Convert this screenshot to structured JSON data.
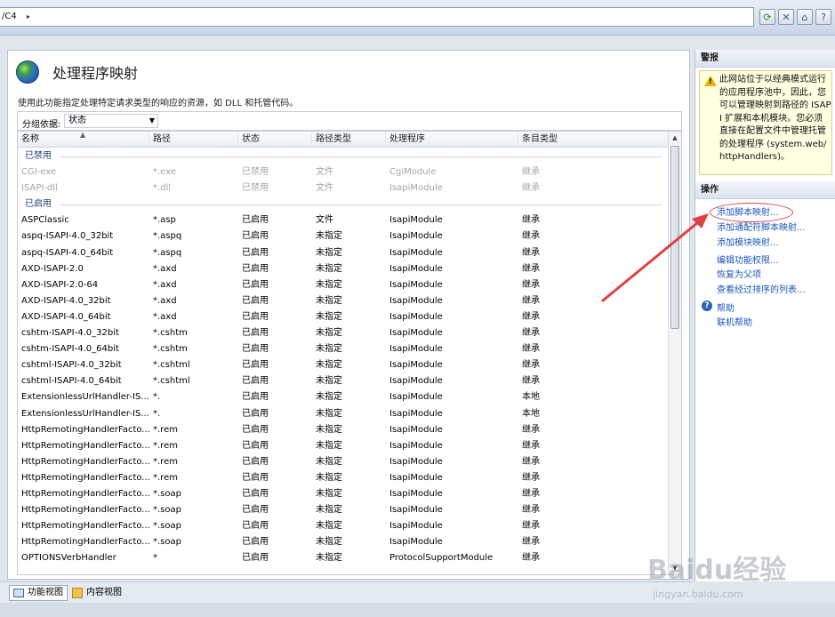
{
  "address": {
    "text": "/C4",
    "separator": "▸"
  },
  "toolbar_icons": [
    "refresh-icon",
    "stop-icon",
    "home-icon",
    "help-icon"
  ],
  "main": {
    "title": "处理程序映射",
    "description": "使用此功能指定处理特定请求类型的响应的资源，如 DLL 和托管代码。",
    "group_by_label": "分组依据:",
    "group_by_value": "状态",
    "columns": [
      "名称",
      "路径",
      "状态",
      "路径类型",
      "处理程序",
      "条目类型"
    ],
    "groups": [
      {
        "label": "已禁用",
        "disabled": true,
        "rows": [
          [
            "CGI-exe",
            "*.exe",
            "已禁用",
            "文件",
            "CgiModule",
            "继承"
          ],
          [
            "ISAPI-dll",
            "*.dll",
            "已禁用",
            "文件",
            "IsapiModule",
            "继承"
          ]
        ]
      },
      {
        "label": "已启用",
        "disabled": false,
        "rows": [
          [
            "ASPClassic",
            "*.asp",
            "已启用",
            "文件",
            "IsapiModule",
            "继承"
          ],
          [
            "aspq-ISAPI-4.0_32bit",
            "*.aspq",
            "已启用",
            "未指定",
            "IsapiModule",
            "继承"
          ],
          [
            "aspq-ISAPI-4.0_64bit",
            "*.aspq",
            "已启用",
            "未指定",
            "IsapiModule",
            "继承"
          ],
          [
            "AXD-ISAPI-2.0",
            "*.axd",
            "已启用",
            "未指定",
            "IsapiModule",
            "继承"
          ],
          [
            "AXD-ISAPI-2.0-64",
            "*.axd",
            "已启用",
            "未指定",
            "IsapiModule",
            "继承"
          ],
          [
            "AXD-ISAPI-4.0_32bit",
            "*.axd",
            "已启用",
            "未指定",
            "IsapiModule",
            "继承"
          ],
          [
            "AXD-ISAPI-4.0_64bit",
            "*.axd",
            "已启用",
            "未指定",
            "IsapiModule",
            "继承"
          ],
          [
            "cshtm-ISAPI-4.0_32bit",
            "*.cshtm",
            "已启用",
            "未指定",
            "IsapiModule",
            "继承"
          ],
          [
            "cshtm-ISAPI-4.0_64bit",
            "*.cshtm",
            "已启用",
            "未指定",
            "IsapiModule",
            "继承"
          ],
          [
            "cshtml-ISAPI-4.0_32bit",
            "*.cshtml",
            "已启用",
            "未指定",
            "IsapiModule",
            "继承"
          ],
          [
            "cshtml-ISAPI-4.0_64bit",
            "*.cshtml",
            "已启用",
            "未指定",
            "IsapiModule",
            "继承"
          ],
          [
            "ExtensionlessUrlHandler-IS...",
            "*.",
            "已启用",
            "未指定",
            "IsapiModule",
            "本地"
          ],
          [
            "ExtensionlessUrlHandler-IS...",
            "*.",
            "已启用",
            "未指定",
            "IsapiModule",
            "本地"
          ],
          [
            "HttpRemotingHandlerFacto...",
            "*.rem",
            "已启用",
            "未指定",
            "IsapiModule",
            "继承"
          ],
          [
            "HttpRemotingHandlerFacto...",
            "*.rem",
            "已启用",
            "未指定",
            "IsapiModule",
            "继承"
          ],
          [
            "HttpRemotingHandlerFacto...",
            "*.rem",
            "已启用",
            "未指定",
            "IsapiModule",
            "继承"
          ],
          [
            "HttpRemotingHandlerFacto...",
            "*.rem",
            "已启用",
            "未指定",
            "IsapiModule",
            "继承"
          ],
          [
            "HttpRemotingHandlerFacto...",
            "*.soap",
            "已启用",
            "未指定",
            "IsapiModule",
            "继承"
          ],
          [
            "HttpRemotingHandlerFacto...",
            "*.soap",
            "已启用",
            "未指定",
            "IsapiModule",
            "继承"
          ],
          [
            "HttpRemotingHandlerFacto...",
            "*.soap",
            "已启用",
            "未指定",
            "IsapiModule",
            "继承"
          ],
          [
            "HttpRemotingHandlerFacto...",
            "*.soap",
            "已启用",
            "未指定",
            "IsapiModule",
            "继承"
          ],
          [
            "OPTIONSVerbHandler",
            "*",
            "已启用",
            "未指定",
            "ProtocolSupportModule",
            "继承"
          ]
        ]
      }
    ]
  },
  "bottom_tabs": [
    {
      "label": "功能视图",
      "active": true
    },
    {
      "label": "内容视图",
      "active": false
    }
  ],
  "pane": {
    "alert_header": "警报",
    "alert_text": "此网站位于以经典模式运行的应用程序池中，因此，您可以管理映射到路径的 ISAPI 扩展和本机模块。您必须直接在配置文件中管理托管的处理程序 (system.web/httpHandlers)。",
    "actions_header": "操作",
    "actions": [
      "添加脚本映射...",
      "添加通配符脚本映射...",
      "添加模块映射...",
      "编辑功能权限...",
      "恢复为父项",
      "查看经过排序的列表...",
      "帮助",
      "联机帮助"
    ]
  },
  "watermark": {
    "logo": "Baidu经验",
    "url": "jingyan.baidu.com"
  },
  "colors": {
    "link": "#1a56b8",
    "alert_bg": "#ffffe1",
    "annotation": "#e04040"
  }
}
